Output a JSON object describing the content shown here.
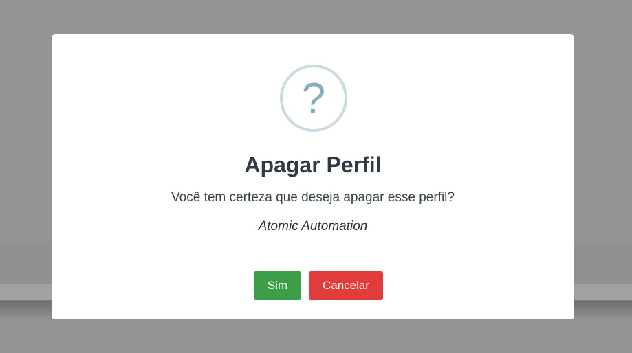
{
  "dialog": {
    "icon": "question-mark-icon",
    "icon_glyph": "?",
    "title": "Apagar Perfil",
    "message": "Você tem certeza que deseja apagar esse perfil?",
    "subject": "Atomic Automation",
    "confirm_label": "Sim",
    "cancel_label": "Cancelar"
  },
  "colors": {
    "overlay": "#939496",
    "dialog_background": "#ffffff",
    "icon_ring": "#c9dae1",
    "icon_glyph": "#87adbd",
    "title_text": "#2f3a44",
    "confirm_button": "#3c9f48",
    "cancel_button": "#e23b3b"
  }
}
